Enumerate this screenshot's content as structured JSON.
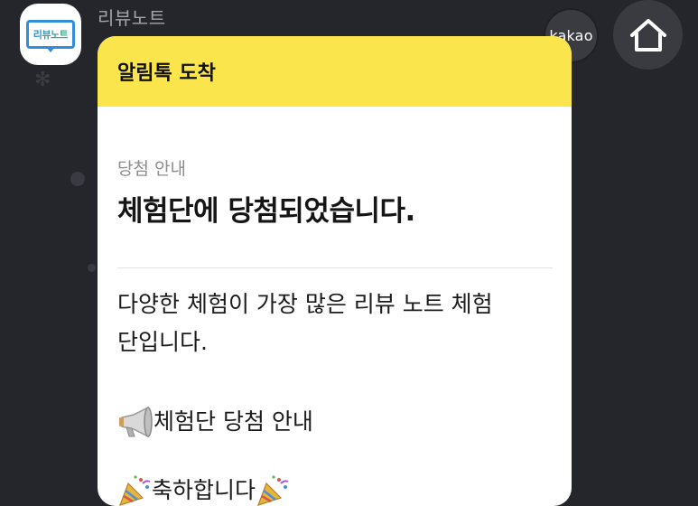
{
  "sender": {
    "name": "리뷰노트",
    "logo_text": "리뷰노트"
  },
  "buttons": {
    "kakao_label": "kakao"
  },
  "message": {
    "header": "알림톡 도착",
    "subtitle": "당첨 안내",
    "headline": "체험단에 당첨되었습니다.",
    "body_line1": "다양한 체험이 가장 많은 리뷰 노트 체험",
    "body_line2": "단입니다.",
    "notice_label": "체험단 당첨 안내",
    "congrats_label": "축하합니다"
  },
  "colors": {
    "background": "#25262c",
    "header_yellow": "#fae54c",
    "logo_blue": "#2f8ddb"
  },
  "icons": {
    "home": "home-icon",
    "megaphone": "megaphone-icon",
    "party": "party-popper-icon"
  }
}
